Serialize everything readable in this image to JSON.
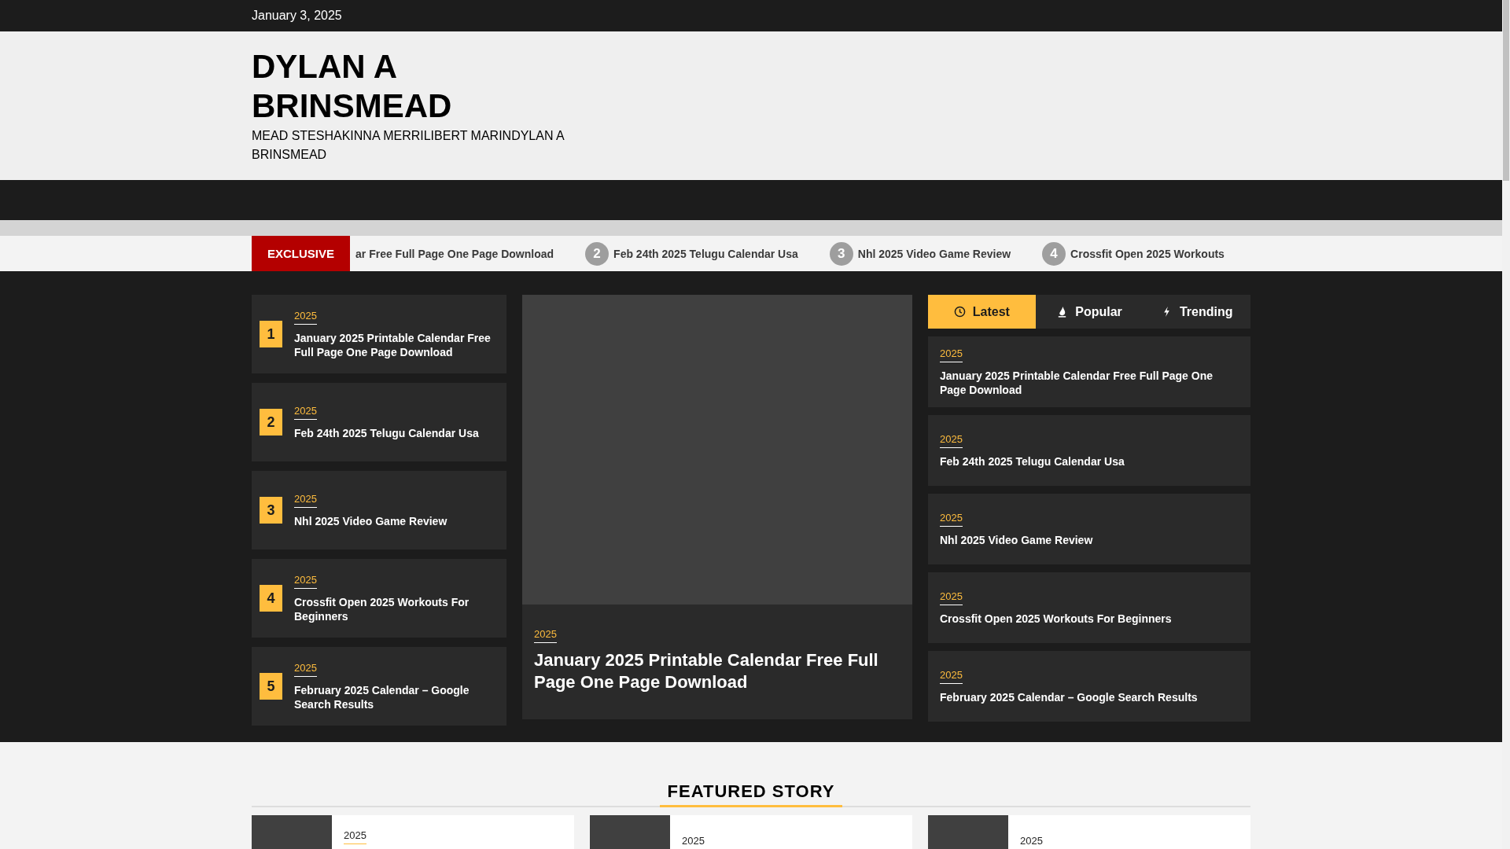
{
  "top_bar": {
    "date": "January 3, 2025"
  },
  "header": {
    "site_title": "DYLAN A BRINSMEAD",
    "tagline": "MEAD STESHAKINNA MERRILIBERT MARINDYLAN A BRINSMEAD"
  },
  "ticker": {
    "label": "EXCLUSIVE",
    "items": [
      {
        "title": "ar Free Full Page One Page Download"
      },
      {
        "number": "2",
        "title": "Feb 24th 2025 Telugu Calendar Usa"
      },
      {
        "number": "3",
        "title": "Nhl 2025 Video Game Review"
      },
      {
        "number": "4",
        "title": "Crossfit Open 2025 Workouts"
      }
    ]
  },
  "ranked_posts": [
    {
      "number": "1",
      "category": "2025",
      "title": "January 2025 Printable Calendar Free Full Page One Page Download"
    },
    {
      "number": "2",
      "category": "2025",
      "title": "Feb 24th 2025 Telugu Calendar Usa"
    },
    {
      "number": "3",
      "category": "2025",
      "title": "Nhl 2025 Video Game Review"
    },
    {
      "number": "4",
      "category": "2025",
      "title": "Crossfit Open 2025 Workouts For Beginners"
    },
    {
      "number": "5",
      "category": "2025",
      "title": "February 2025 Calendar – Google Search Results"
    }
  ],
  "main_story": {
    "category": "2025",
    "title": "January 2025 Printable Calendar Free Full Page One Page Download"
  },
  "tabs": [
    {
      "label": "Latest",
      "kind": "clock",
      "selected": true
    },
    {
      "label": "Popular",
      "kind": "fire",
      "selected": false
    },
    {
      "label": "Trending",
      "kind": "bolt",
      "selected": false
    }
  ],
  "tab_posts": [
    {
      "category": "2025",
      "title": "January 2025 Printable Calendar Free Full Page One Page Download"
    },
    {
      "category": "2025",
      "title": "Feb 24th 2025 Telugu Calendar Usa"
    },
    {
      "category": "2025",
      "title": "Nhl 2025 Video Game Review"
    },
    {
      "category": "2025",
      "title": "Crossfit Open 2025 Workouts For Beginners"
    },
    {
      "category": "2025",
      "title": "February 2025 Calendar – Google Search Results"
    }
  ],
  "featured": {
    "heading": "FEATURED STORY",
    "cards": [
      {
        "category": "2025"
      },
      {
        "category": "2025"
      },
      {
        "category": "2025"
      }
    ]
  }
}
